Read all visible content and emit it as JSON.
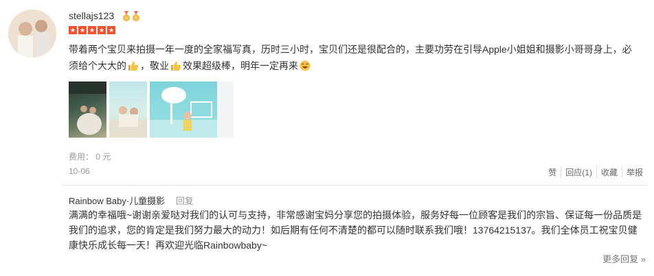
{
  "user": {
    "name": "stellajs123"
  },
  "review": {
    "text_part1": "带着两个宝贝来拍摄一年一度的全家福写真，历时三小时，宝贝们还是很配合的，主要功劳在引导Apple小姐姐和摄影小哥哥身上，必须给个大大的",
    "text_part2": "，敬业",
    "text_part3": "效果超级棒，明年一定再来",
    "rating": 5,
    "fee": "费用：  0 元",
    "date": "10-06"
  },
  "actions": {
    "like": "赞",
    "reply": "回应(1)",
    "favorite": "收藏",
    "report": "举报"
  },
  "merchant_reply": {
    "name": "Rainbow Baby·儿童摄影",
    "reply_label": "回复",
    "text": "满满的幸福哦~谢谢亲爱哒对我们的认可与支持，非常感谢宝妈分享您的拍摄体验，服务好每一位顾客是我们的宗旨、保证每一份品质是我们的追求，您的肯定是我们努力最大的动力！如后期有任何不清楚的都可以随时联系我们哦！13764215137。我们全体员工祝宝贝健康快乐成长每一天！再欢迎光临Rainbowbaby~"
  },
  "more_replies": "更多回复 »",
  "colors": {
    "star": "#f5522f",
    "accent": "#333333"
  },
  "icons": [
    "medal-icon",
    "star-icon",
    "thumbs-up-icon",
    "laughing-emoji-icon"
  ]
}
